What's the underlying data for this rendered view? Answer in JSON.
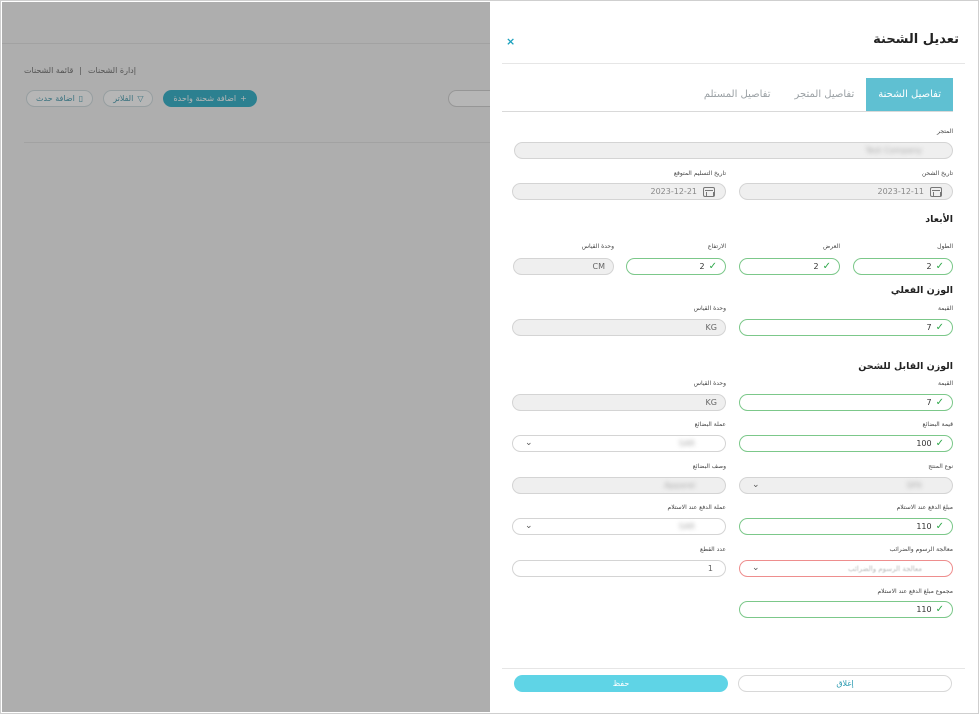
{
  "background": {
    "breadcrumb": {
      "root": "إدارة الشحنات",
      "current": "قائمة الشحنات"
    },
    "toolbar": {
      "add_single_label": "اضافة شحنة واحدة",
      "filters_label": "الفلاتر",
      "add_event_label": "اضافة حدث"
    }
  },
  "drawer": {
    "title": "تعديل الشحنة",
    "close_symbol": "×",
    "tabs": [
      {
        "label": "تفاصيل الشحنة",
        "active": true
      },
      {
        "label": "تفاصيل المتجر",
        "active": false
      },
      {
        "label": "تفاصيل المستلم",
        "active": false
      }
    ],
    "store": {
      "label": "المتجر",
      "value": "Test Company"
    },
    "ship_date": {
      "label": "تاريخ الشحن",
      "value": "2023-12-11"
    },
    "delivery_date": {
      "label": "تاريخ التسليم المتوقع",
      "value": "2023-12-21"
    },
    "dimensions": {
      "title": "الأبعاد",
      "length": {
        "label": "الطول",
        "value": "2"
      },
      "width": {
        "label": "العرض",
        "value": "2"
      },
      "height": {
        "label": "الارتفاع",
        "value": "2"
      },
      "unit": {
        "label": "وحدة القياس",
        "value": "CM"
      }
    },
    "actual_weight": {
      "title": "الوزن الفعلي",
      "value": {
        "label": "القيمة",
        "value": "7"
      },
      "unit": {
        "label": "وحدة القياس",
        "value": "KG"
      }
    },
    "chargeable_weight": {
      "title": "الوزن القابل للشحن",
      "value": {
        "label": "القيمة",
        "value": "7"
      },
      "unit": {
        "label": "وحدة القياس",
        "value": "KG"
      }
    },
    "goods_value": {
      "label": "قيمة البضائع",
      "value": "100"
    },
    "goods_currency": {
      "label": "عملة البضائع",
      "value": "SAR"
    },
    "product_type": {
      "label": "نوع المنتج",
      "value": "SPX"
    },
    "goods_description": {
      "label": "وصف البضائع",
      "value": "Apparel"
    },
    "cod_amount": {
      "label": "مبلغ الدفع عند الاستلام",
      "value": "110"
    },
    "cod_currency": {
      "label": "عملة الدفع عند الاستلام",
      "value": "SAR"
    },
    "duties_handling": {
      "label": "معالجة الرسوم والضرائب",
      "placeholder": "معالجة الرسوم والضرائب"
    },
    "pieces": {
      "label": "عدد القطع",
      "value": "1"
    },
    "cod_total": {
      "label": "مجموع مبلغ الدفع عند الاستلام",
      "value": "110"
    },
    "footer": {
      "close_label": "إغلاق",
      "save_label": "حفظ"
    }
  },
  "colors": {
    "accent": "#12a2bd",
    "active_tab": "#5fc0d2",
    "valid": "#7cc88a",
    "error": "#ee8e8e"
  }
}
